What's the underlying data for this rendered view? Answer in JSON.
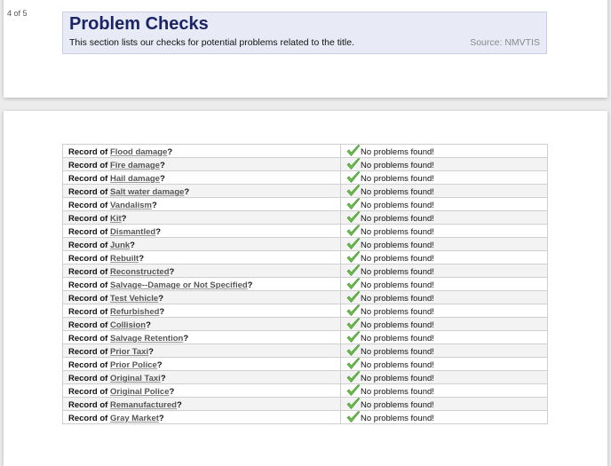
{
  "page_indicator": "4 of 5",
  "header": {
    "title": "Problem Checks",
    "description": "This section lists our checks for potential problems related to the title.",
    "source": "Source: NMVTIS"
  },
  "checks": {
    "prefix": "Record of",
    "result": "No problems found!",
    "status_icon": "check-icon",
    "check_color": "#6cc24a",
    "items": [
      "Flood damage",
      "Fire damage",
      "Hail damage",
      "Salt water damage",
      "Vandalism",
      "Kit",
      "Dismantled",
      "Junk",
      "Rebuilt",
      "Reconstructed",
      "Salvage--Damage or Not Specified",
      "Test Vehicle",
      "Refurbished",
      "Collision",
      "Salvage Retention",
      "Prior Taxi",
      "Prior Police",
      "Original Taxi",
      "Original Police",
      "Remanufactured",
      "Gray Market"
    ]
  }
}
